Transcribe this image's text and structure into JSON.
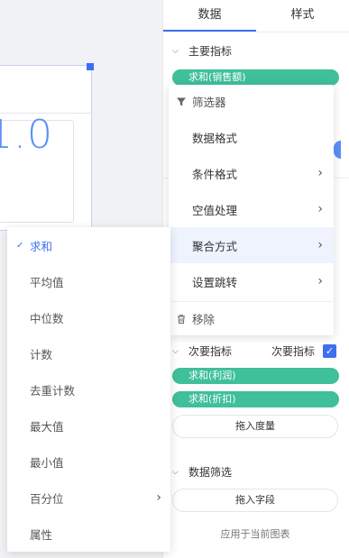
{
  "canvas": {
    "kpi_value": "1.0"
  },
  "panel": {
    "tabs": [
      {
        "label": "数据",
        "active": true
      },
      {
        "label": "样式",
        "active": false
      }
    ],
    "primary_metric": {
      "title": "主要指标",
      "pill": "求和(销售额)"
    },
    "secondary_metric": {
      "title": "次要指标",
      "toggle_label": "次要指标",
      "toggle_checked": true,
      "pills": [
        "求和(利润)",
        "求和(折扣)"
      ],
      "drop_label": "拖入度量"
    },
    "data_filter": {
      "title": "数据筛选",
      "drop_label": "拖入字段",
      "hint": "应用于当前图表"
    }
  },
  "context_menu": {
    "filter": "筛选器",
    "items": [
      {
        "label": "数据格式",
        "has_submenu": false
      },
      {
        "label": "条件格式",
        "has_submenu": true
      },
      {
        "label": "空值处理",
        "has_submenu": true
      },
      {
        "label": "聚合方式",
        "has_submenu": true,
        "highlighted": true
      },
      {
        "label": "设置跳转",
        "has_submenu": true
      }
    ],
    "remove": "移除"
  },
  "aggregation_submenu": {
    "items": [
      {
        "label": "求和",
        "selected": true
      },
      {
        "label": "平均值"
      },
      {
        "label": "中位数"
      },
      {
        "label": "计数"
      },
      {
        "label": "去重计数"
      },
      {
        "label": "最大值"
      },
      {
        "label": "最小值"
      },
      {
        "label": "百分位",
        "has_submenu": true
      },
      {
        "label": "属性"
      }
    ]
  },
  "colors": {
    "accent": "#3d6ff0",
    "pill": "#3fbf9a",
    "kpi": "#5b8ff9",
    "highlight": "#eef3fe"
  }
}
